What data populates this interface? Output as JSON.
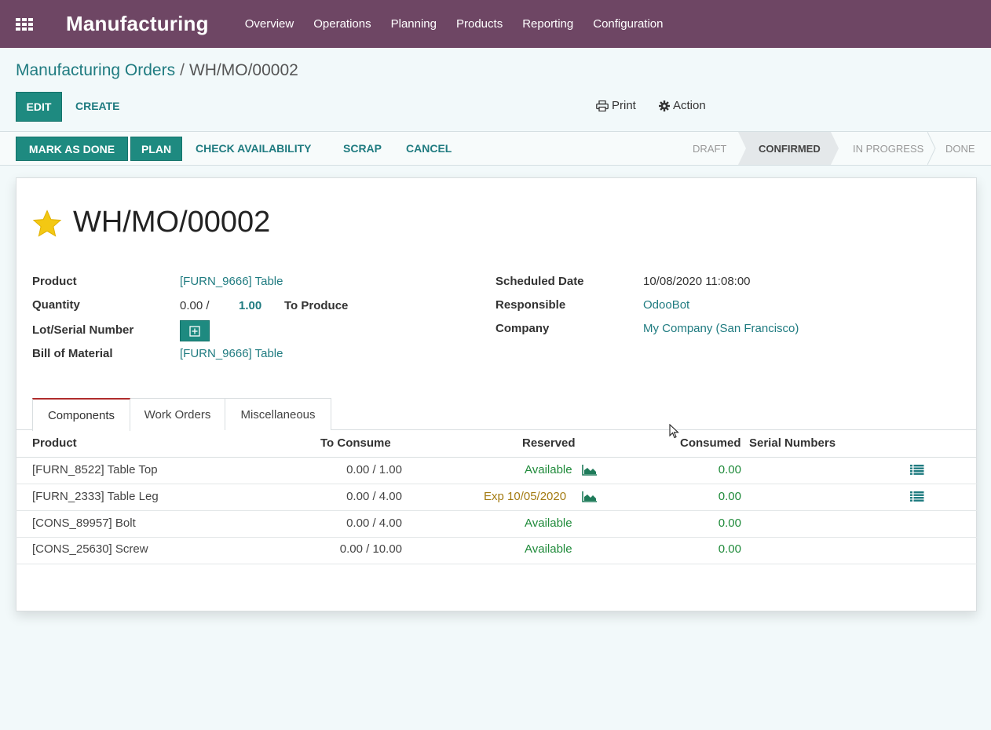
{
  "navbar": {
    "app_name": "Manufacturing",
    "menu": [
      "Overview",
      "Operations",
      "Planning",
      "Products",
      "Reporting",
      "Configuration"
    ]
  },
  "breadcrumb": {
    "parent": "Manufacturing Orders",
    "separator": "/",
    "current": "WH/MO/00002"
  },
  "control_panel": {
    "edit": "EDIT",
    "create": "CREATE",
    "print": "Print",
    "action": "Action"
  },
  "statusbar": {
    "buttons": [
      "MARK AS DONE",
      "PLAN",
      "CHECK AVAILABILITY",
      "SCRAP",
      "CANCEL"
    ],
    "stages": [
      "DRAFT",
      "CONFIRMED",
      "IN PROGRESS",
      "DONE"
    ],
    "current_stage": "CONFIRMED"
  },
  "form": {
    "title": "WH/MO/00002",
    "favorite": true,
    "left": {
      "product_label": "Product",
      "product_value": "[FURN_9666] Table",
      "quantity_label": "Quantity",
      "quantity_done": "0.00 /",
      "quantity_todo": "1.00",
      "quantity_suffix": "To Produce",
      "lot_label": "Lot/Serial Number",
      "bom_label": "Bill of Material",
      "bom_value": "[FURN_9666] Table"
    },
    "right": {
      "scheduled_label": "Scheduled Date",
      "scheduled_value": "10/08/2020 11:08:00",
      "responsible_label": "Responsible",
      "responsible_value": "OdooBot",
      "company_label": "Company",
      "company_value": "My Company (San Francisco)"
    }
  },
  "tabs": [
    "Components",
    "Work Orders",
    "Miscellaneous"
  ],
  "table": {
    "headers": {
      "product": "Product",
      "to_consume": "To Consume",
      "reserved": "Reserved",
      "consumed": "Consumed",
      "serial": "Serial Numbers"
    },
    "rows": [
      {
        "product": "[FURN_8522] Table Top",
        "to_consume": "0.00 / 1.00",
        "reserved": "Available",
        "consumed": "0.00"
      },
      {
        "product": "[FURN_2333] Table Leg",
        "to_consume": "0.00 / 4.00",
        "reserved": "Exp 10/05/2020",
        "consumed": "0.00"
      },
      {
        "product": "[CONS_89957] Bolt",
        "to_consume": "0.00 / 4.00",
        "reserved": "Available",
        "consumed": "0.00"
      },
      {
        "product": "[CONS_25630] Screw",
        "to_consume": "0.00 / 10.00",
        "reserved": "Available",
        "consumed": "0.00"
      }
    ]
  },
  "colors": {
    "navbar": "#6e4664",
    "primary": "#1e8a80",
    "link": "#1f7b80",
    "available": "#1f8a3a",
    "warning": "#a47b12",
    "star": "#f3c813"
  }
}
